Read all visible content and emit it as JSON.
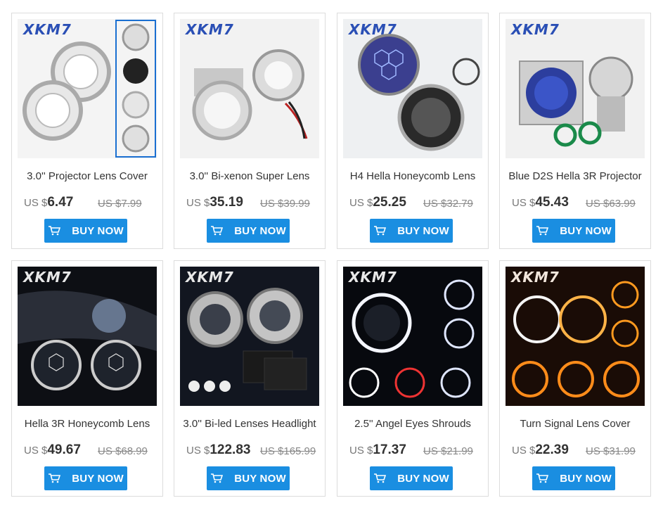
{
  "buy_label": "BUY NOW",
  "currency": "US $",
  "colors": {
    "button": "#1a8ee1",
    "logo_blue": "#2a4fb5"
  },
  "products": [
    {
      "name": "3.0'' Projector Lens Cover",
      "price": "6.47",
      "old_price": "US $7.99",
      "logo": "XKM7",
      "theme": "light"
    },
    {
      "name": "3.0'' Bi-xenon Super Lens",
      "price": "35.19",
      "old_price": "US $39.99",
      "logo": "XKM7",
      "theme": "light"
    },
    {
      "name": "H4 Hella Honeycomb Lens",
      "price": "25.25",
      "old_price": "US $32.79",
      "logo": "XKM7",
      "theme": "light"
    },
    {
      "name": "Blue D2S Hella 3R Projector",
      "price": "45.43",
      "old_price": "US $63.99",
      "logo": "XKM7",
      "theme": "light"
    },
    {
      "name": "Hella 3R Honeycomb Lens",
      "price": "49.67",
      "old_price": "US $68.99",
      "logo": "XKM7",
      "theme": "dark"
    },
    {
      "name": "3.0'' Bi-led Lenses Headlight",
      "price": "122.83",
      "old_price": "US $165.99",
      "logo": "XKM7",
      "theme": "dark"
    },
    {
      "name": "2.5'' Angel Eyes Shrouds",
      "price": "17.37",
      "old_price": "US $21.99",
      "logo": "XKM7",
      "theme": "dark"
    },
    {
      "name": "Turn Signal Lens Cover",
      "price": "22.39",
      "old_price": "US $31.99",
      "logo": "XKM7",
      "theme": "dark"
    }
  ]
}
